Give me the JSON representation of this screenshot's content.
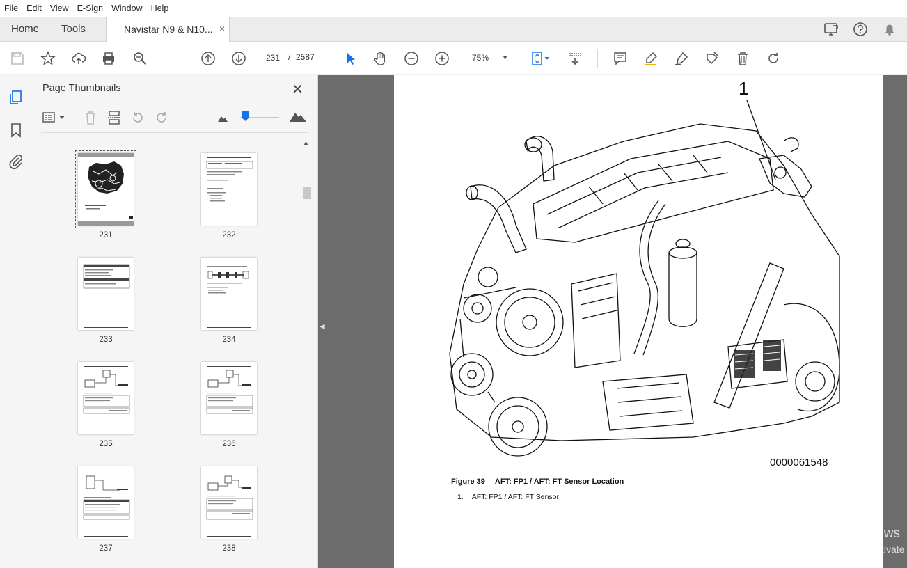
{
  "menu": [
    "File",
    "Edit",
    "View",
    "E-Sign",
    "Window",
    "Help"
  ],
  "tabs": {
    "home": "Home",
    "tools": "Tools",
    "document": "Navistar N9 & N10...",
    "close": "×"
  },
  "toolbar": {
    "current_page": "231",
    "separator": "/",
    "total_pages": "2587",
    "zoom": "75%"
  },
  "panel": {
    "title": "Page Thumbnails",
    "thumbnails": [
      {
        "label": "231",
        "selected": true
      },
      {
        "label": "232",
        "selected": false
      },
      {
        "label": "233",
        "selected": false
      },
      {
        "label": "234",
        "selected": false
      },
      {
        "label": "235",
        "selected": false
      },
      {
        "label": "236",
        "selected": false
      },
      {
        "label": "237",
        "selected": false
      },
      {
        "label": "238",
        "selected": false
      }
    ]
  },
  "document": {
    "callout": "1",
    "figure_number": "0000061548",
    "caption_label": "Figure 39",
    "caption_title": "AFT: FP1 / AFT: FT Sensor Location",
    "items": [
      {
        "number": "1.",
        "text": "AFT: FP1 / AFT: FT Sensor"
      }
    ]
  },
  "watermark": {
    "line1": "Activate Windows",
    "line2": "Go to Settings to activate Windows."
  },
  "colors": {
    "accent": "#1473e6",
    "doc_background": "#6c6c6c"
  }
}
